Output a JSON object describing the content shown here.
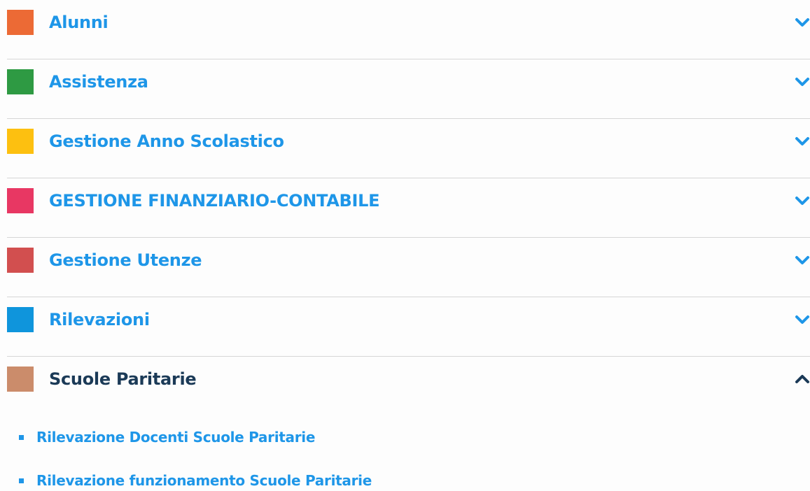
{
  "accordion": {
    "items": [
      {
        "label": "Alunni",
        "color": "#ec6a35",
        "state": "collapsed",
        "icon": "chevron-down-icon"
      },
      {
        "label": "Assistenza",
        "color": "#2e9a43",
        "state": "collapsed",
        "icon": "chevron-down-icon"
      },
      {
        "label": "Gestione Anno Scolastico",
        "color": "#fdc010",
        "state": "collapsed",
        "icon": "chevron-down-icon"
      },
      {
        "label": "GESTIONE FINANZIARIO-CONTABILE",
        "color": "#e83763",
        "state": "collapsed",
        "icon": "chevron-down-icon"
      },
      {
        "label": "Gestione Utenze",
        "color": "#d24f4f",
        "state": "collapsed",
        "icon": "chevron-down-icon"
      },
      {
        "label": "Rilevazioni",
        "color": "#0f95dc",
        "state": "collapsed",
        "icon": "chevron-down-icon"
      },
      {
        "label": "Scuole Paritarie",
        "color": "#cb8c6b",
        "state": "expanded",
        "icon": "chevron-up-icon"
      }
    ],
    "expanded_subitems": [
      {
        "label": "Rilevazione Docenti Scuole Paritarie"
      },
      {
        "label": "Rilevazione funzionamento Scuole Paritarie"
      }
    ]
  },
  "colors": {
    "link": "#1e96e8",
    "active_label": "#1b3a57",
    "divider": "#d6d6d6"
  }
}
